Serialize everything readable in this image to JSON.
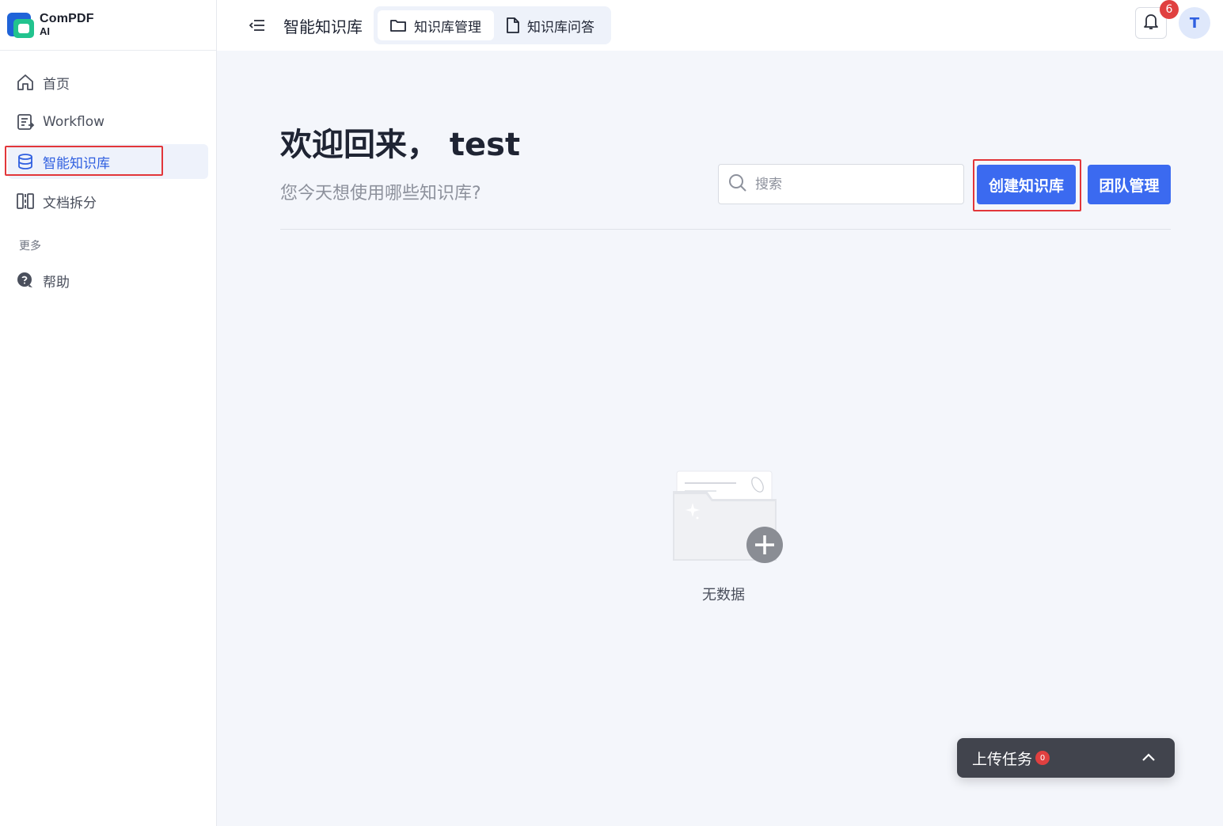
{
  "logo": {
    "line1": "ComPDF",
    "line2": "AI",
    "brand_blue": "#1f63d8",
    "brand_green": "#22c38e"
  },
  "sidebar": {
    "items": [
      {
        "label": "首页",
        "icon": "home-icon"
      },
      {
        "label": "Workflow",
        "icon": "workflow-icon"
      },
      {
        "label": "智能知识库",
        "icon": "database-icon",
        "active": true
      },
      {
        "label": "文档拆分",
        "icon": "split-icon"
      }
    ],
    "more_label": "更多",
    "more_items": [
      {
        "label": "帮助",
        "icon": "help-icon"
      }
    ]
  },
  "header": {
    "title": "智能知识库",
    "tabs": [
      {
        "label": "知识库管理",
        "icon": "folder-icon",
        "active": true
      },
      {
        "label": "知识库问答",
        "icon": "file-icon"
      }
    ],
    "notification_count": "6",
    "avatar_initial": "T"
  },
  "main": {
    "welcome": "欢迎回来， test",
    "subtitle": "您今天想使用哪些知识库?",
    "search_placeholder": "搜索",
    "create_button": "创建知识库",
    "team_button": "团队管理",
    "empty_text": "无数据"
  },
  "upload": {
    "label": "上传任务",
    "count": "0"
  },
  "colors": {
    "accent": "#3b6af0",
    "highlight": "#e2363a",
    "badge": "#e04040"
  }
}
